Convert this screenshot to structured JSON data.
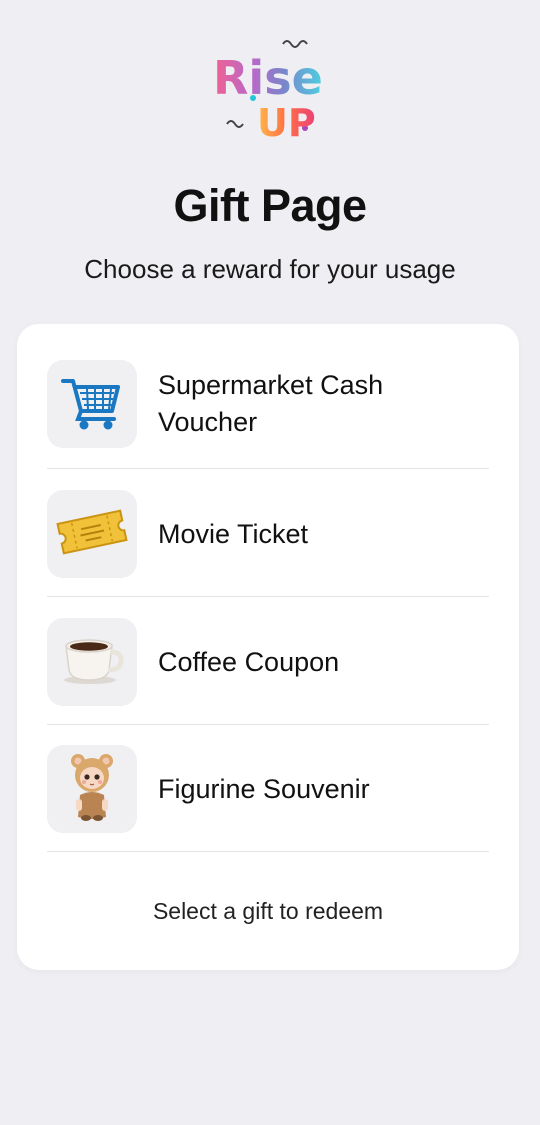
{
  "logo": {
    "line1": "Rise",
    "line2": "UP",
    "icon": "rise-up-logo"
  },
  "header": {
    "title": "Gift Page",
    "subtitle": "Choose a reward for your usage"
  },
  "gifts": [
    {
      "label_line1": "Supermarket Cash",
      "label_line2": "Voucher",
      "icon": "shopping-cart-icon"
    },
    {
      "label_line1": "Movie Ticket",
      "icon": "ticket-icon"
    },
    {
      "label_line1": "Coffee Coupon",
      "icon": "coffee-cup-icon"
    },
    {
      "label_line1": "Figurine Souvenir",
      "icon": "figurine-icon"
    }
  ],
  "footer": {
    "hint": "Select a gift to redeem"
  },
  "colors": {
    "background": "#efeff3",
    "card": "#ffffff",
    "icon_tile": "#f0f0f3",
    "cart_blue": "#1a78c2",
    "ticket_gold": "#f2c13a"
  }
}
